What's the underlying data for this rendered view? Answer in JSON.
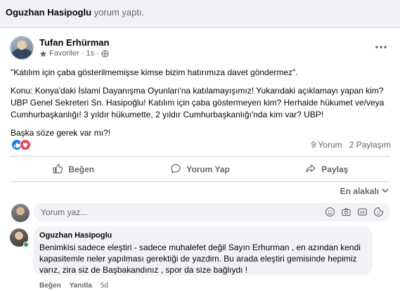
{
  "notice": {
    "name": "Oguzhan Hasipoglu",
    "text": "yorum yaptı."
  },
  "post": {
    "author": "Tufan Erhürman",
    "audience": "Favoriler",
    "time": "1s",
    "paragraphs": [
      "\"Katılım için çaba gösterilmemişse kimse bizim hatırımıza davet göndermez\".",
      "Konu: Konya'daki İslami Dayanışma Oyunları'na katılamayışımız! Yukarıdaki açıklamayı yapan kim? UBP Genel Sekreteri Sn. Hasipoğlu! Katılım için çaba göstermeyen kim? Herhalde hükumet ve/veya Cumhurbaşkanlığı! 3 yıldır hükumette, 2 yıldır Cumhurbaşkanlığı'nda kim var? UBP!",
      "Başka söze gerek var mı?!"
    ],
    "comments_count": "9 Yorum",
    "shares_count": "2 Paylaşım"
  },
  "actions": {
    "like": "Beğen",
    "comment": "Yorum Yap",
    "share": "Paylaş"
  },
  "sort_label": "En alakalı",
  "compose": {
    "placeholder": "Yorum yaz..."
  },
  "comment": {
    "author": "Oguzhan Hasipoglu",
    "text": "Benimkisi sadece eleştiri - sadece muhalefet değil Sayın Erhurman , en azından kendi kapasitemle neler yapılması gerektiği de yazdim. Bu arada eleştiri gemisinde hepimiz varız, zira siz de Başbakandınız , spor da size bağlıydı !",
    "like": "Beğen",
    "reply": "Yanıtla",
    "time": "5d"
  },
  "icons": {
    "audience": "star-icon",
    "globe": "globe-icon",
    "more": "more-horizontal-icon",
    "reactions": [
      "like-reaction-icon",
      "love-reaction-icon"
    ],
    "compose": [
      "emoji-icon",
      "camera-icon",
      "gif-icon",
      "sticker-icon"
    ]
  },
  "colors": {
    "accent": "#1877f2",
    "love": "#f33e58",
    "secondary_text": "#65676b",
    "online": "#31a24c"
  }
}
